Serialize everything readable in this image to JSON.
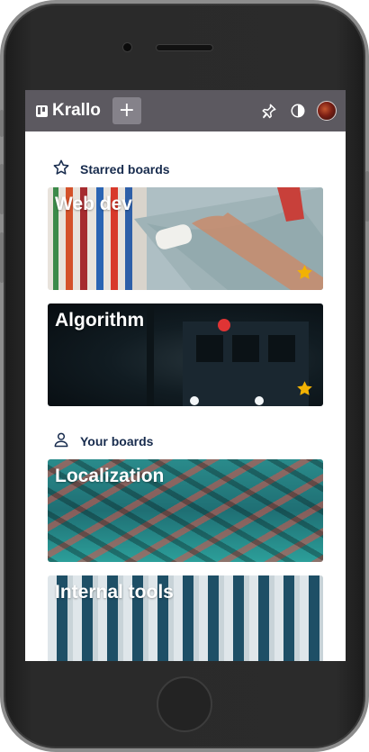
{
  "app": {
    "name": "Krallo",
    "add_label": "+"
  },
  "colors": {
    "topbar": "#5c5960",
    "accent_star": "#f2b203",
    "section_title": "#172b4d"
  },
  "icons": {
    "brand": "board-icon",
    "pin": "pin-icon",
    "theme": "half-circle-icon",
    "avatar": "user-avatar",
    "starred": "star-outline-icon",
    "yours": "person-icon"
  },
  "sections": {
    "starred": {
      "title": "Starred boards",
      "boards": [
        {
          "title": "Web dev",
          "starred": true
        },
        {
          "title": "Algorithm",
          "starred": true
        }
      ]
    },
    "yours": {
      "title": "Your boards",
      "boards": [
        {
          "title": "Localization",
          "starred": false
        },
        {
          "title": "Internal tools",
          "starred": false
        }
      ]
    }
  }
}
